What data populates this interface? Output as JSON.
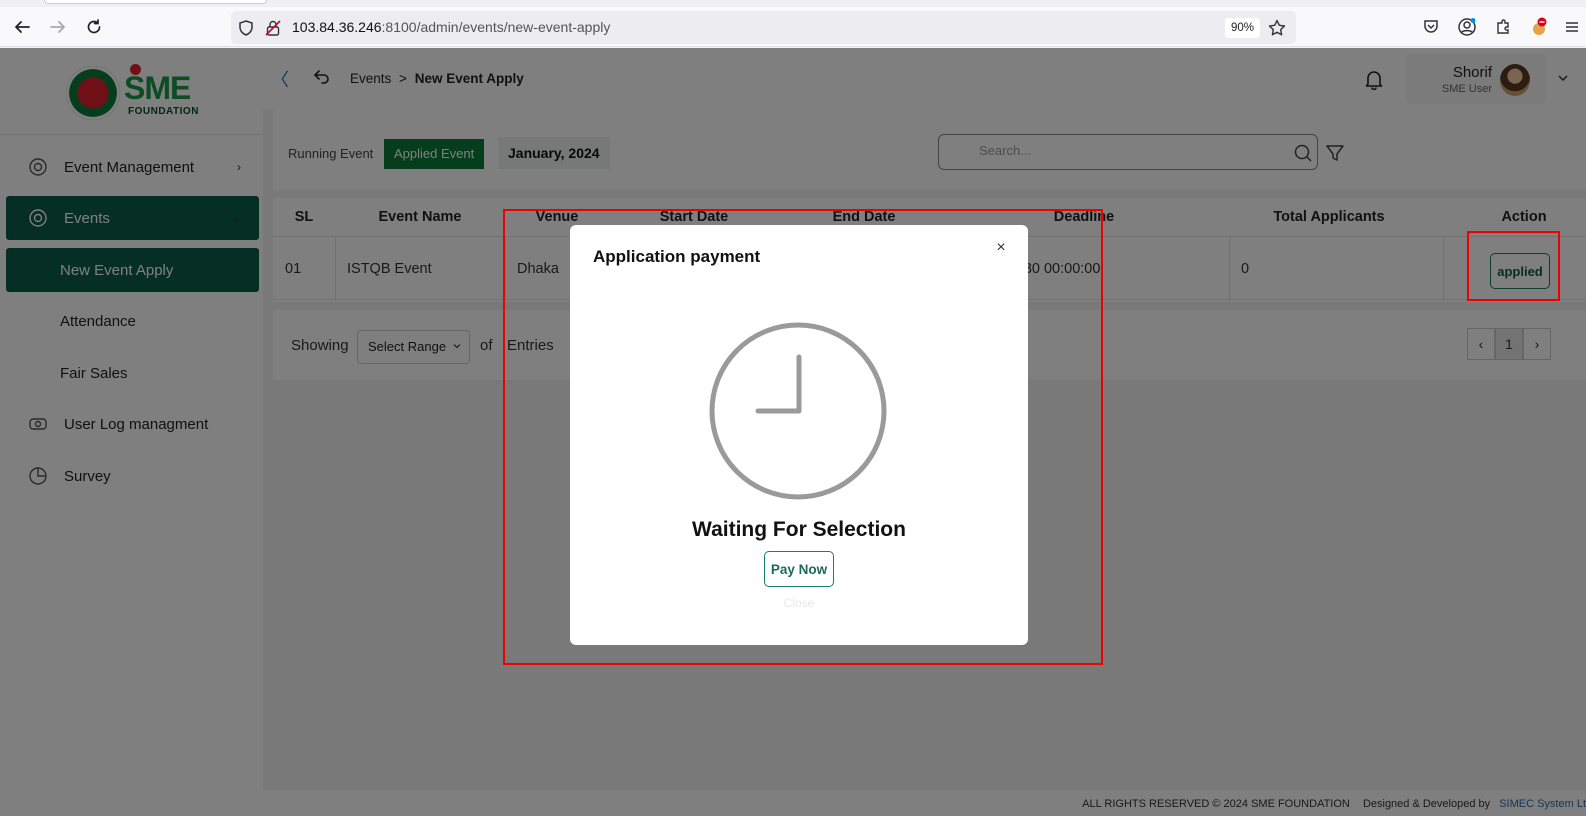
{
  "browser": {
    "url_host": "103.84.36.246",
    "url_rest": ":8100/admin/events/new-event-apply",
    "zoom": "90%"
  },
  "sidebar": {
    "logo_text": "SME",
    "logo_sub": "FOUNDATION",
    "items": [
      {
        "label": "Event Management",
        "chev": "›"
      },
      {
        "label": "Events",
        "chev": "⌄"
      },
      {
        "label": "New Event Apply"
      },
      {
        "label": "Attendance"
      },
      {
        "label": "Fair Sales"
      },
      {
        "label": "User Log managment"
      },
      {
        "label": "Survey"
      }
    ]
  },
  "header": {
    "collapse": "〈",
    "breadcrumb": {
      "parent": "Events",
      "sep": ">",
      "current": "New Event Apply"
    },
    "user": {
      "name": "Shorif",
      "role": "SME User"
    }
  },
  "filters": {
    "tabs": [
      "Running Event",
      "Applied Event"
    ],
    "month": "January, 2024",
    "search_placeholder": "Search..."
  },
  "table": {
    "headers": [
      "SL",
      "Event Name",
      "Venue",
      "Start Date",
      "End Date",
      "Deadline",
      "Total Applicants",
      "Action"
    ],
    "rows": [
      {
        "sl": "01",
        "event_name": "ISTQB Event",
        "venue": "Dhaka",
        "deadline": "-30 00:00:00",
        "total_applicants": "0",
        "action": "applied"
      }
    ]
  },
  "pager": {
    "showing": "Showing",
    "range_select": "Select Range",
    "of": "of",
    "entries": "Entries",
    "prev": "‹",
    "page": "1",
    "next": "›"
  },
  "footer": {
    "rights": "ALL RIGHTS RESERVED © 2024 SME FOUNDATION",
    "designed": "Designed & Developed by",
    "dev_link": "SIMEC System Lt"
  },
  "modal": {
    "title": "Application payment",
    "close": "×",
    "status": "Waiting For Selection",
    "pay_label": "Pay Now",
    "close_label": "Close"
  },
  "colors": {
    "brand_green": "#0b5e44",
    "annotation_red": "#e00000"
  }
}
